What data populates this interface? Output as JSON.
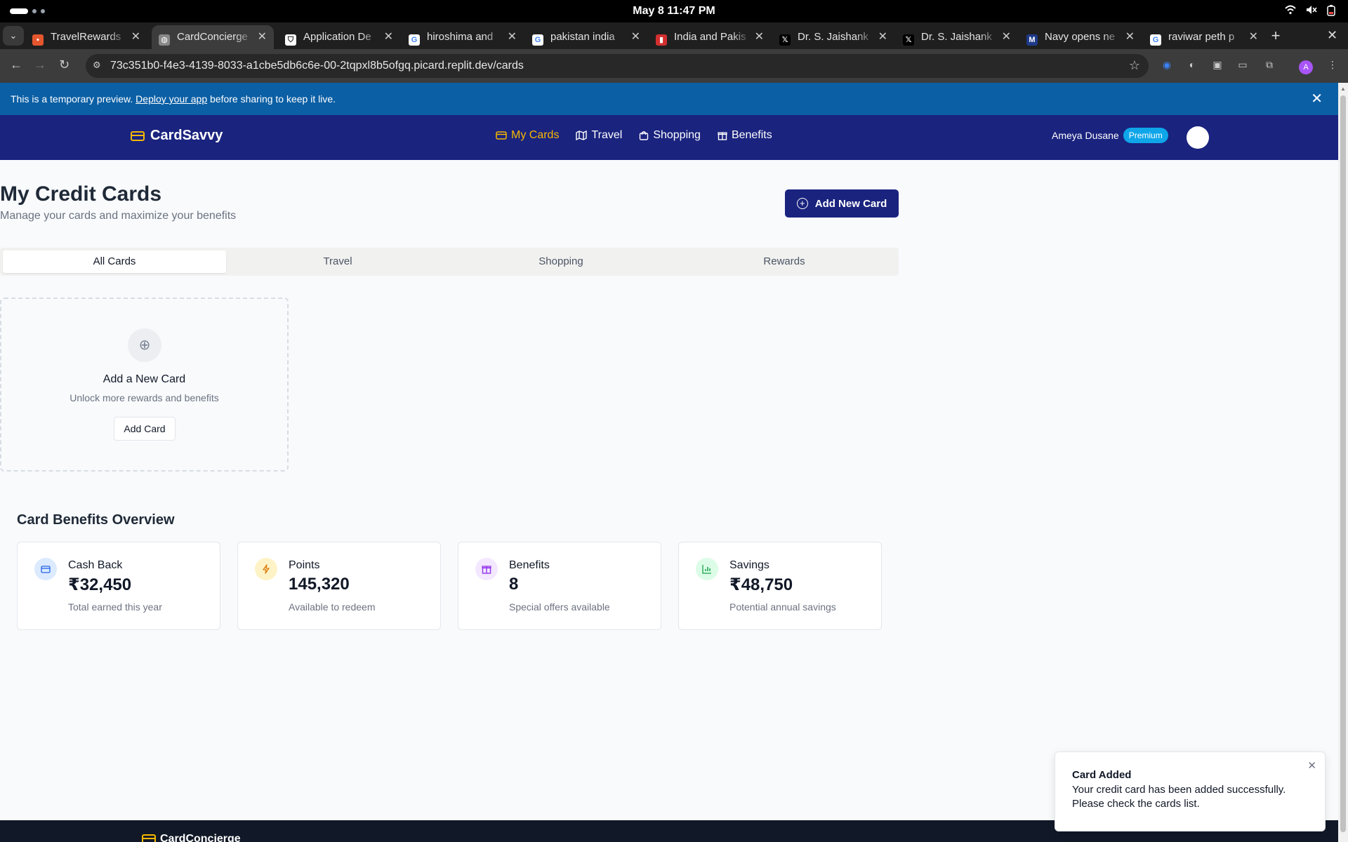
{
  "os": {
    "clock": "May 8  11:47 PM"
  },
  "browser": {
    "tabs": [
      {
        "title": "TravelRewards",
        "favicon": "grid-icon"
      },
      {
        "title": "CardConcierge",
        "favicon": "globe-icon"
      },
      {
        "title": "Application De",
        "favicon": "shield-icon"
      },
      {
        "title": "hiroshima and",
        "favicon": "google-icon"
      },
      {
        "title": "pakistan india",
        "favicon": "google-icon"
      },
      {
        "title": "India and Pakis",
        "favicon": "flag-icon"
      },
      {
        "title": "Dr. S. Jaishank",
        "favicon": "x-icon"
      },
      {
        "title": "Dr. S. Jaishank",
        "favicon": "x-icon"
      },
      {
        "title": "Navy opens ne",
        "favicon": "m-icon"
      },
      {
        "title": "raviwar peth p",
        "favicon": "google-icon"
      }
    ],
    "active_tab": 1,
    "url": "73c351b0-f4e3-4139-8033-a1cbe5db6c6e-00-2tqpxl8b5ofgq.picard.replit.dev/cards",
    "profile_initial": "A"
  },
  "banner": {
    "before": "This is a temporary preview. ",
    "link": "Deploy your app",
    "after": " before sharing to keep it live."
  },
  "header": {
    "brand": "CardSavvy",
    "nav": [
      {
        "label": "My Cards",
        "icon": "credit-card-icon",
        "active": true
      },
      {
        "label": "Travel",
        "icon": "map-icon",
        "active": false
      },
      {
        "label": "Shopping",
        "icon": "shopping-bag-icon",
        "active": false
      },
      {
        "label": "Benefits",
        "icon": "gift-icon",
        "active": false
      }
    ],
    "user_name": "Ameya Dusane",
    "badge": "Premium"
  },
  "page": {
    "title": "My Credit Cards",
    "subtitle": "Manage your cards and maximize your benefits",
    "add_button": "Add New Card",
    "tabs": [
      "All Cards",
      "Travel",
      "Shopping",
      "Rewards"
    ],
    "active_tab": 0
  },
  "add_card": {
    "heading": "Add a New Card",
    "subtext": "Unlock more rewards and benefits",
    "button": "Add Card"
  },
  "overview": {
    "title": "Card Benefits Overview",
    "stats": [
      {
        "label": "Cash Back",
        "value": "₹32,450",
        "sub": "Total earned this year",
        "icon": "credit-card-icon",
        "color": "#2563eb",
        "bg": "#dbeafe"
      },
      {
        "label": "Points",
        "value": "145,320",
        "sub": "Available to redeem",
        "icon": "lightning-icon",
        "color": "#d97706",
        "bg": "#fef3c7"
      },
      {
        "label": "Benefits",
        "value": "8",
        "sub": "Special offers available",
        "icon": "gift-icon",
        "color": "#9333ea",
        "bg": "#f3e8ff"
      },
      {
        "label": "Savings",
        "value": "₹48,750",
        "sub": "Potential annual savings",
        "icon": "bar-chart-icon",
        "color": "#16a34a",
        "bg": "#dcfce7"
      }
    ]
  },
  "footer": {
    "brand": "CardConcierge"
  },
  "toast": {
    "title": "Card Added",
    "message": "Your credit card has been added successfully. Please check the cards list."
  },
  "colors": {
    "header_bg": "#1a237e",
    "accent": "#f5b800",
    "banner_bg": "#0b5fa5",
    "premium": "#0ea5e9"
  }
}
